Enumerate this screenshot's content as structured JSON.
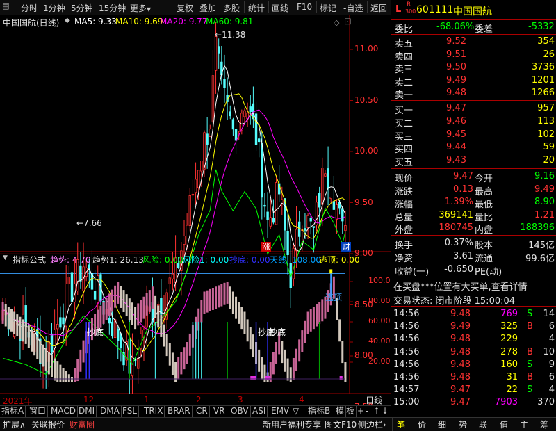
{
  "toolbar": {
    "left": [
      "分时",
      "1分钟",
      "5分钟",
      "15分钟",
      "更多"
    ],
    "right": [
      "复权",
      "叠加",
      "多股",
      "统计",
      "画线",
      "F10",
      "标记",
      "-自选",
      "返回"
    ]
  },
  "main_chart": {
    "title": "中国国航(日线)",
    "ma": [
      {
        "label": "MA5: 9.33",
        "color": "#ffffff"
      },
      {
        "label": "MA10: 9.69",
        "color": "#ffff00"
      },
      {
        "label": "MA20: 9.77",
        "color": "#ff00ff"
      },
      {
        "label": "MA60: 9.81",
        "color": "#00ff00"
      }
    ],
    "price_ticks": [
      "11.00",
      "10.50",
      "10.00",
      "9.50",
      "9.00",
      "8.50",
      "8.00",
      "7.50"
    ],
    "high_label": "11.38",
    "low_label": "7.66",
    "markers": {
      "zhang": "涨",
      "cai": "财"
    },
    "colors": {
      "up": "#ff3232",
      "down": "#54fcfc",
      "ma5": "#ffffff",
      "ma10": "#ffff00",
      "ma20": "#ff00ff",
      "ma60": "#00ff00",
      "axis": "#c00000"
    }
  },
  "indicator": {
    "name": "指标公式",
    "items": [
      {
        "label": "趋势: 4.70",
        "color": "#ff80ff"
      },
      {
        "label": "趋势1: 26.13",
        "color": "#e0e0e0"
      },
      {
        "label": "风险: 0.00",
        "color": "#00ff00"
      },
      {
        "label": "风险1: 0.00",
        "color": "#00ffff"
      },
      {
        "label": "抄底: 0.00",
        "color": "#3030ff"
      },
      {
        "label": "天线: 108.00",
        "color": "#00a0ff"
      },
      {
        "label": "逃顶: 0.00",
        "color": "#ffff00"
      }
    ],
    "ticks": [
      "100.0",
      "80.00",
      "60.00",
      "40.00",
      "20.00"
    ],
    "annotations": {
      "chaodi": "抄底",
      "taoding": "逃顶"
    }
  },
  "time_axis": {
    "year": "2021年",
    "months": [
      "12",
      "1",
      "2",
      "3",
      "4"
    ],
    "period": "日线"
  },
  "tabs": [
    "指标A",
    "窗口",
    "MACD",
    "DMI",
    "DMA",
    "FSL",
    "TRIX",
    "BRAR",
    "CR",
    "VR",
    "OBV",
    "ASI",
    "EMV",
    "指标B",
    "模",
    "板"
  ],
  "tab_controls": {
    "add": "+",
    "remove": "-",
    "up": "↑",
    "down": "↓"
  },
  "bottom": {
    "left": [
      "扩展∧",
      "关联报价",
      "财富圈"
    ],
    "right": [
      "新用户福利专享",
      "图文F10",
      "侧边栏"
    ],
    "tools": [
      "笔",
      "价",
      "细",
      "势",
      "联",
      "值",
      "主",
      "筹"
    ]
  },
  "quote": {
    "market_mark": "L",
    "r_mark": "R",
    "index_code": "300",
    "code": "601111",
    "name": "中国国航",
    "webi_label": "委比",
    "webi": "-68.06%",
    "weicha_label": "委差",
    "weicha": "-5332",
    "sells": [
      {
        "label": "卖五",
        "price": "9.52",
        "vol": "354"
      },
      {
        "label": "卖四",
        "price": "9.51",
        "vol": "26"
      },
      {
        "label": "卖三",
        "price": "9.50",
        "vol": "3736"
      },
      {
        "label": "卖二",
        "price": "9.49",
        "vol": "1201"
      },
      {
        "label": "卖一",
        "price": "9.48",
        "vol": "1266"
      }
    ],
    "buys": [
      {
        "label": "买一",
        "price": "9.47",
        "vol": "957"
      },
      {
        "label": "买二",
        "price": "9.46",
        "vol": "113"
      },
      {
        "label": "买三",
        "price": "9.45",
        "vol": "102"
      },
      {
        "label": "买四",
        "price": "9.44",
        "vol": "59"
      },
      {
        "label": "买五",
        "price": "9.43",
        "vol": "20"
      }
    ],
    "stats": [
      {
        "l1": "现价",
        "v1": "9.47",
        "c1": "#ff3232",
        "l2": "今开",
        "v2": "9.16",
        "c2": "#00ff00"
      },
      {
        "l1": "涨跌",
        "v1": "0.13",
        "c1": "#ff3232",
        "l2": "最高",
        "v2": "9.49",
        "c2": "#ff3232"
      },
      {
        "l1": "涨幅",
        "v1": "1.39%",
        "c1": "#ff3232",
        "l2": "最低",
        "v2": "8.90",
        "c2": "#00ff00"
      },
      {
        "l1": "总量",
        "v1": "369141",
        "c1": "#ffff00",
        "l2": "量比",
        "v2": "1.21",
        "c2": "#ff3232"
      },
      {
        "l1": "外盘",
        "v1": "180745",
        "c1": "#ff3232",
        "l2": "内盘",
        "v2": "188396",
        "c2": "#00ff00"
      }
    ],
    "stats2": [
      {
        "l1": "换手",
        "v1": "0.37%",
        "l2": "股本",
        "v2": "145亿"
      },
      {
        "l1": "净资",
        "v1": "3.61",
        "l2": "流通",
        "v2": "99.6亿"
      },
      {
        "l1": "收益(一)",
        "v1": "-0.650",
        "l2": "PE(动)",
        "v2": ""
      }
    ],
    "notice": "在买盘***位置有大买单,查看详情",
    "status": "交易状态: 闭市阶段 15:00:04",
    "ticks": [
      {
        "time": "14:56",
        "price": "9.48",
        "vol": "769",
        "vcolor": "#ff00ff",
        "bs": "S",
        "bscolor": "#00ff00",
        "n": "14"
      },
      {
        "time": "14:56",
        "price": "9.49",
        "vol": "325",
        "vcolor": "#ffff00",
        "bs": "B",
        "bscolor": "#ff3232",
        "n": "6"
      },
      {
        "time": "14:56",
        "price": "9.48",
        "vol": "229",
        "vcolor": "#ffff00",
        "bs": "",
        "bscolor": "#fff",
        "n": "4"
      },
      {
        "time": "14:56",
        "price": "9.48",
        "vol": "278",
        "vcolor": "#ffff00",
        "bs": "B",
        "bscolor": "#ff3232",
        "n": "10"
      },
      {
        "time": "14:56",
        "price": "9.48",
        "vol": "160",
        "vcolor": "#ffff00",
        "bs": "S",
        "bscolor": "#00ff00",
        "n": "9"
      },
      {
        "time": "14:56",
        "price": "9.48",
        "vol": "31",
        "vcolor": "#ffff00",
        "bs": "B",
        "bscolor": "#ff3232",
        "n": "6"
      },
      {
        "time": "14:57",
        "price": "9.47",
        "vol": "22",
        "vcolor": "#ffff00",
        "bs": "S",
        "bscolor": "#00ff00",
        "n": "4"
      },
      {
        "time": "15:00",
        "price": "9.47",
        "vol": "7903",
        "vcolor": "#ff00ff",
        "bs": "",
        "bscolor": "#fff",
        "n": "370"
      }
    ]
  }
}
